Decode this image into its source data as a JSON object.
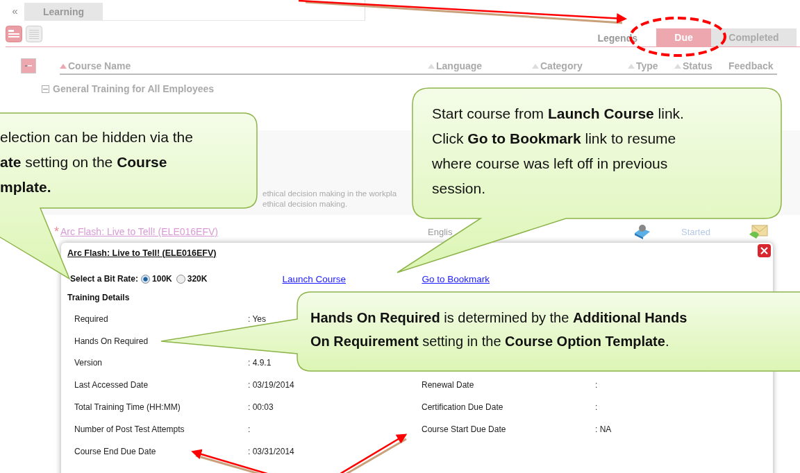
{
  "nav": {
    "collapse": "«",
    "tabs": [
      {
        "label": "Learning",
        "selected": true
      }
    ]
  },
  "legend": {
    "label": "Legends",
    "items": [
      {
        "label": "Due",
        "selected": true
      },
      {
        "label": "Completed",
        "selected": false
      }
    ]
  },
  "columns": [
    {
      "label": "Course Name",
      "sortable": true,
      "sorted": true
    },
    {
      "label": "Language",
      "sortable": true,
      "sorted": false
    },
    {
      "label": "Category",
      "sortable": true,
      "sorted": false
    },
    {
      "label": "Type",
      "sortable": true,
      "sorted": false
    },
    {
      "label": "Status",
      "sortable": true,
      "sorted": false
    },
    {
      "label": "Feedback",
      "sortable": false
    }
  ],
  "group": {
    "title": "General Training for All Employees",
    "expanded": true
  },
  "description_lines": [
    "ethical decision making in the workpla",
    "ethical decision making."
  ],
  "course": {
    "mark": "*",
    "title": "Arc Flash: Live to Tell!  (ELE016EFV)",
    "language": "Englis",
    "status": "Started"
  },
  "popup": {
    "title": "Arc Flash: Live to Tell!  (ELE016EFV)",
    "bit_rate_label": "Select a Bit Rate:",
    "bit_rates": [
      {
        "label": "100K",
        "selected": true
      },
      {
        "label": "320K",
        "selected": false
      }
    ],
    "links": [
      "Launch Course",
      "Go to Bookmark"
    ],
    "details_title": "Training Details",
    "rows": [
      {
        "label": "Required",
        "value": ": Yes"
      },
      {
        "label": "Hands On Required"
      },
      {
        "label": "Version",
        "value": ": 4.9.1"
      },
      {
        "label": "Last Accessed Date",
        "value": ": 03/19/2014",
        "extra": {
          "label": "Renewal Date",
          "value": ":"
        }
      },
      {
        "label": "Total Training Time (HH:MM)",
        "value": ": 00:03",
        "extra": {
          "label": "Certification Due Date",
          "value": ":"
        }
      },
      {
        "label": "Number of Post Test Attempts",
        "value": ":",
        "extra": {
          "label": "Course Start Due Date",
          "value": ": NA"
        }
      },
      {
        "label": "Course End Due Date",
        "value": ": 03/31/2014"
      }
    ]
  },
  "callouts": [
    {
      "text": "election can be hidden via the\n**ate** setting on the **Course**\n**mplate.**"
    },
    {
      "text": "Start course from **Launch Course** link.\nClick **Go to Bookmark** link to resume\nwhere course was left off in previous\nsession."
    },
    {
      "text": "**Hands On Required** is determined by the **Additional Hands**\n**On Requirement** setting in the **Course Option Template**."
    }
  ]
}
